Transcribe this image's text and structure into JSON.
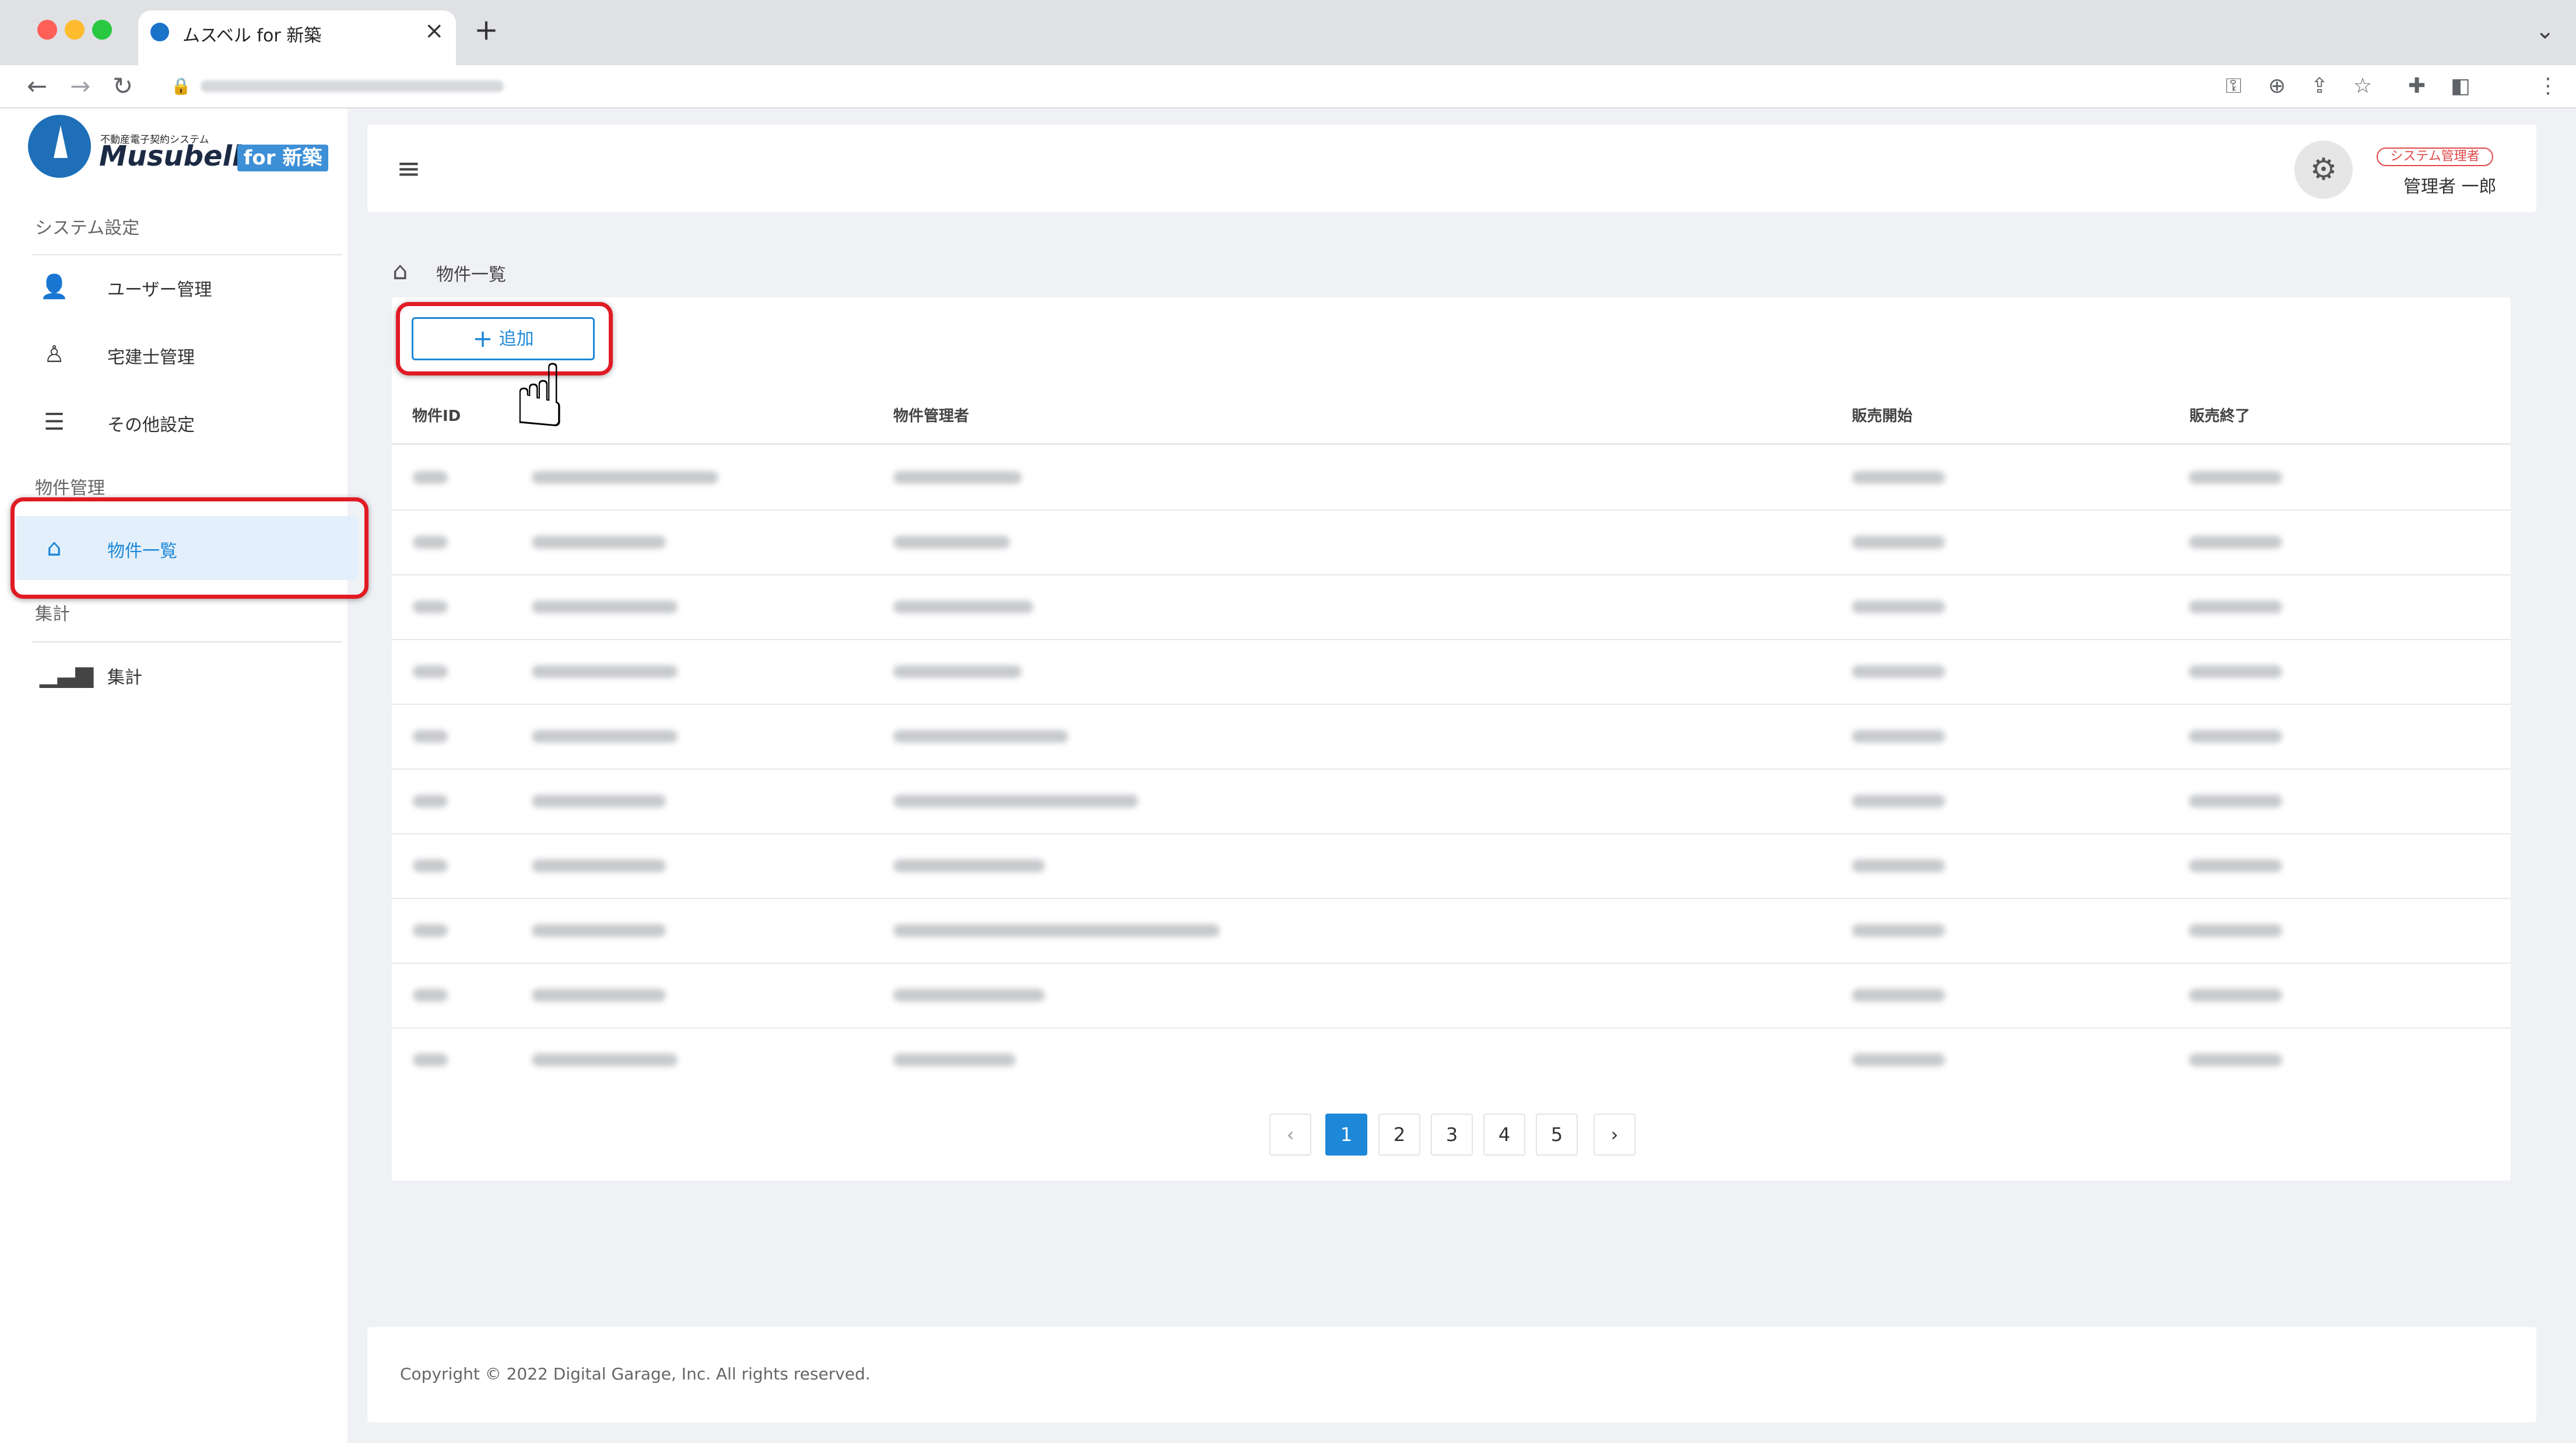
{
  "browser": {
    "tab_title": "ムスベル for 新築",
    "tab_close": "×",
    "new_tab": "+",
    "tab_menu": "⌄"
  },
  "logo": {
    "subtitle": "不動産電子契約システム",
    "name": "Musubell",
    "badge": "for 新築"
  },
  "sidebar": {
    "sections": [
      {
        "label": "システム設定",
        "items": [
          {
            "label": "ユーザー管理",
            "icon": "person-icon"
          },
          {
            "label": "宅建士管理",
            "icon": "agent-icon"
          },
          {
            "label": "その他設定",
            "icon": "list-icon"
          }
        ]
      },
      {
        "label": "物件管理",
        "items": [
          {
            "label": "物件一覧",
            "icon": "building-icon",
            "active": true
          }
        ]
      },
      {
        "label": "集計",
        "items": [
          {
            "label": "集計",
            "icon": "bar-chart-icon"
          }
        ]
      }
    ]
  },
  "header": {
    "role_badge": "システム管理者",
    "user_name": "管理者 一郎"
  },
  "breadcrumb": {
    "label": "物件一覧"
  },
  "actions": {
    "add_label": "追加",
    "add_icon": "+"
  },
  "table": {
    "columns": [
      "物件ID",
      "物件管理者",
      "販売開始",
      "販売終了"
    ],
    "row_count_visible": 10,
    "rows_blurred": true
  },
  "pagination": {
    "pages": [
      "1",
      "2",
      "3",
      "4",
      "5"
    ],
    "current": "1",
    "prev": "‹",
    "next": "›"
  },
  "footer": {
    "copyright": "Copyright © 2022 Digital Garage, Inc. All rights reserved."
  },
  "colors": {
    "accent": "#1e88d8",
    "highlight": "#e01b24",
    "background": "#f0f1f5",
    "role_badge": "#e04848"
  }
}
